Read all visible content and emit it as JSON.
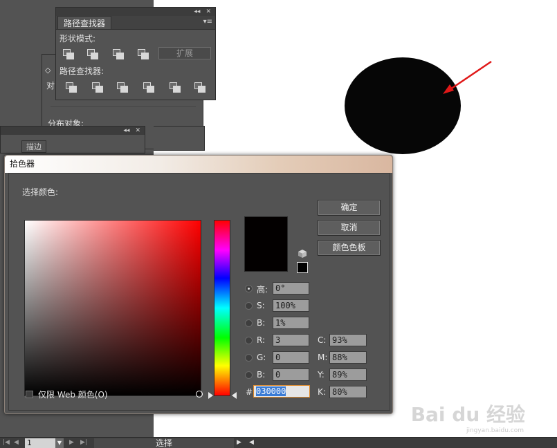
{
  "pathfinder_panel": {
    "tab": "路径查找器",
    "shape_modes_label": "形状模式:",
    "expand_button": "扩展",
    "pathfinders_label": "路径查找器:",
    "collapse_glyph": "◂◂",
    "close_glyph": "✕",
    "menu_glyph": "▾≡"
  },
  "align_panel": {
    "partial_label_1": "对",
    "distribute_label": "分布对象:",
    "partial_label_2": "描"
  },
  "stroke_panel": {
    "tab": "描边"
  },
  "color_picker": {
    "title": "拾色器",
    "select_color_label": "选择颜色:",
    "ok_button": "确定",
    "cancel_button": "取消",
    "swatches_button": "颜色色板",
    "fields": [
      {
        "label": "高:",
        "value": "0°",
        "checked": true
      },
      {
        "label": "S:",
        "value": "100%",
        "checked": false
      },
      {
        "label": "B:",
        "value": "1%",
        "checked": false
      },
      {
        "label": "R:",
        "value": "3",
        "checked": false
      },
      {
        "label": "G:",
        "value": "0",
        "checked": false
      },
      {
        "label": "B:",
        "value": "0",
        "checked": false
      }
    ],
    "cmyk": [
      {
        "label": "C:",
        "value": "93%"
      },
      {
        "label": "M:",
        "value": "88%"
      },
      {
        "label": "Y:",
        "value": "89%"
      },
      {
        "label": "K:",
        "value": "80%"
      }
    ],
    "hex_label": "#",
    "hex_value": "030000",
    "web_only_label": "仅限 Web 颜色(O)",
    "current_color": "#030000"
  },
  "statusbar": {
    "page_value": "1",
    "status_text": "选择",
    "nav_first": "|◀",
    "nav_prev": "◀",
    "nav_next": "▶",
    "nav_last": "▶|",
    "dropdown_glyph": "▼",
    "play_glyph": "▶",
    "back_glyph": "◀"
  },
  "watermark": {
    "brand": "Bai du 经验",
    "url": "jingyan.baidu.com"
  }
}
